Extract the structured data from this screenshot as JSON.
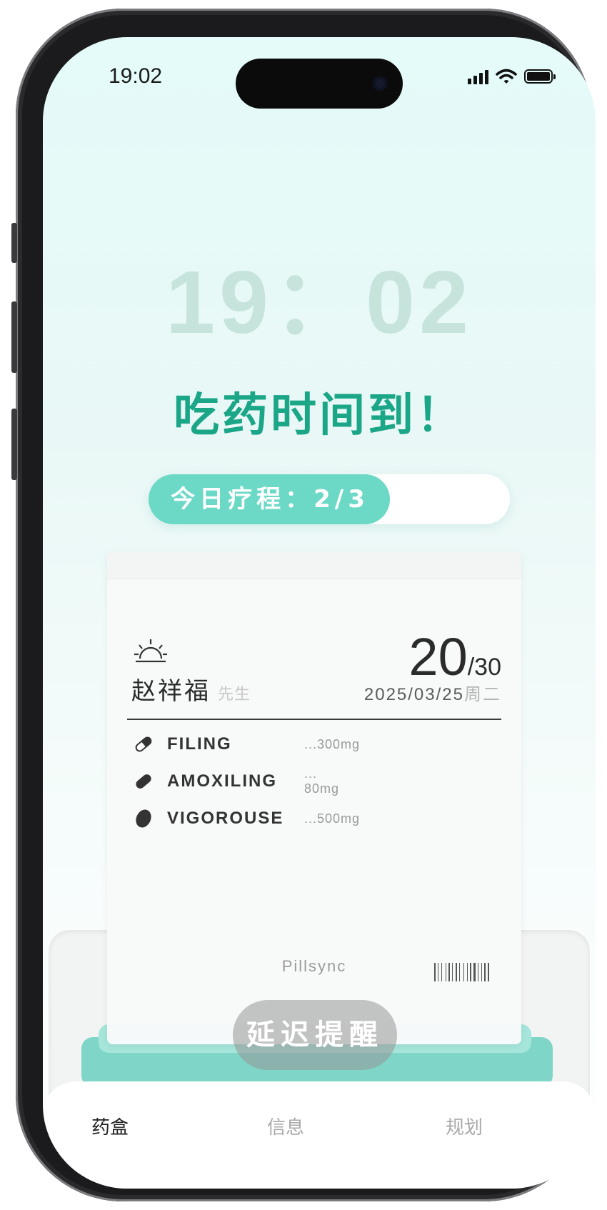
{
  "status_bar": {
    "time": "19:02"
  },
  "clock": "19：02",
  "headline": "吃药时间到！",
  "progress": {
    "label": "今日疗程：2/3",
    "value": 0.667
  },
  "pouch": {
    "time_of_day_icon": "sunrise-icon",
    "patient_name": "赵祥福",
    "title_suffix": "先生",
    "count_current": "20",
    "count_total": "/30",
    "date": "2025/03/25",
    "weekday": "周二",
    "medications": [
      {
        "name": "FILING",
        "dose": "...300mg",
        "icon": "capsule-icon"
      },
      {
        "name": "AMOXILING",
        "dose": "... 80mg",
        "icon": "oblong-pill-icon"
      },
      {
        "name": "VIGOROUSE",
        "dose": "...500mg",
        "icon": "oval-pill-icon"
      }
    ],
    "brand": "Pillsync"
  },
  "snooze_button": "延迟提醒",
  "tabs": [
    {
      "label": "药盒",
      "active": true
    },
    {
      "label": "信息",
      "active": false
    },
    {
      "label": "规划",
      "active": false
    }
  ],
  "colors": {
    "accent": "#1aa687",
    "progress_fill": "#6cd9c7",
    "clock": "#c6e3dc"
  }
}
